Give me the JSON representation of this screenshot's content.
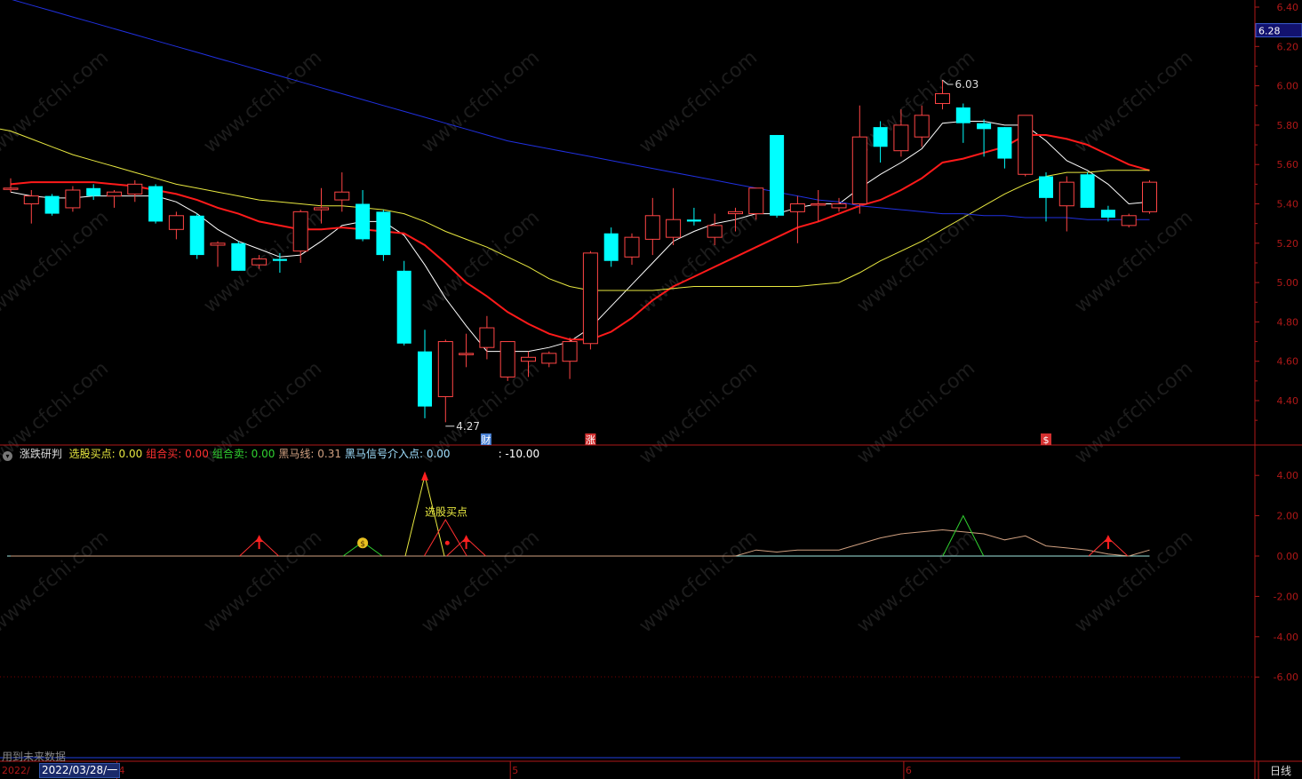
{
  "chart_data": [
    {
      "type": "candlestick",
      "ylim": [
        4.2,
        6.4
      ],
      "y_ticks": [
        "6.40",
        "6.20",
        "6.00",
        "5.80",
        "5.60",
        "5.40",
        "5.20",
        "5.00",
        "4.80",
        "4.60",
        "4.40"
      ],
      "price_marker": "6.28",
      "annotations": {
        "high_label": "6.03",
        "low_label": "4.27"
      },
      "event_markers": [
        {
          "label": "财",
          "index": 23,
          "color": "#4b83d6"
        },
        {
          "label": "涨",
          "index": 28,
          "color": "#d23030"
        },
        {
          "label": "$",
          "index": 50,
          "color": "#d23030"
        }
      ],
      "candles": [
        {
          "o": 5.48,
          "h": 5.53,
          "l": 5.46,
          "c": 5.48
        },
        {
          "o": 5.4,
          "h": 5.47,
          "l": 5.3,
          "c": 5.44
        },
        {
          "o": 5.44,
          "h": 5.45,
          "l": 5.34,
          "c": 5.35
        },
        {
          "o": 5.38,
          "h": 5.49,
          "l": 5.36,
          "c": 5.47
        },
        {
          "o": 5.48,
          "h": 5.5,
          "l": 5.42,
          "c": 5.44
        },
        {
          "o": 5.44,
          "h": 5.47,
          "l": 5.38,
          "c": 5.46
        },
        {
          "o": 5.45,
          "h": 5.52,
          "l": 5.41,
          "c": 5.5
        },
        {
          "o": 5.49,
          "h": 5.5,
          "l": 5.3,
          "c": 5.31
        },
        {
          "o": 5.27,
          "h": 5.36,
          "l": 5.22,
          "c": 5.34
        },
        {
          "o": 5.34,
          "h": 5.35,
          "l": 5.12,
          "c": 5.14
        },
        {
          "o": 5.19,
          "h": 5.21,
          "l": 5.08,
          "c": 5.2
        },
        {
          "o": 5.2,
          "h": 5.21,
          "l": 5.06,
          "c": 5.06
        },
        {
          "o": 5.09,
          "h": 5.14,
          "l": 5.07,
          "c": 5.12
        },
        {
          "o": 5.12,
          "h": 5.15,
          "l": 5.05,
          "c": 5.11
        },
        {
          "o": 5.16,
          "h": 5.37,
          "l": 5.1,
          "c": 5.36
        },
        {
          "o": 5.37,
          "h": 5.48,
          "l": 5.3,
          "c": 5.38
        },
        {
          "o": 5.42,
          "h": 5.56,
          "l": 5.36,
          "c": 5.46
        },
        {
          "o": 5.4,
          "h": 5.47,
          "l": 5.21,
          "c": 5.22
        },
        {
          "o": 5.36,
          "h": 5.37,
          "l": 5.11,
          "c": 5.14
        },
        {
          "o": 5.06,
          "h": 5.11,
          "l": 4.68,
          "c": 4.69
        },
        {
          "o": 4.65,
          "h": 4.76,
          "l": 4.31,
          "c": 4.37
        },
        {
          "o": 4.42,
          "h": 4.71,
          "l": 4.29,
          "c": 4.7
        },
        {
          "o": 4.64,
          "h": 4.74,
          "l": 4.57,
          "c": 4.64
        },
        {
          "o": 4.67,
          "h": 4.83,
          "l": 4.61,
          "c": 4.77
        },
        {
          "o": 4.52,
          "h": 4.7,
          "l": 4.5,
          "c": 4.7
        },
        {
          "o": 4.6,
          "h": 4.65,
          "l": 4.52,
          "c": 4.62
        },
        {
          "o": 4.59,
          "h": 4.65,
          "l": 4.57,
          "c": 4.64
        },
        {
          "o": 4.6,
          "h": 4.72,
          "l": 4.51,
          "c": 4.7
        },
        {
          "o": 4.69,
          "h": 5.16,
          "l": 4.66,
          "c": 5.15
        },
        {
          "o": 5.25,
          "h": 5.28,
          "l": 5.08,
          "c": 5.11
        },
        {
          "o": 5.13,
          "h": 5.25,
          "l": 5.09,
          "c": 5.23
        },
        {
          "o": 5.22,
          "h": 5.43,
          "l": 5.14,
          "c": 5.34
        },
        {
          "o": 5.23,
          "h": 5.48,
          "l": 5.19,
          "c": 5.32
        },
        {
          "o": 5.32,
          "h": 5.38,
          "l": 5.29,
          "c": 5.31
        },
        {
          "o": 5.23,
          "h": 5.35,
          "l": 5.19,
          "c": 5.29
        },
        {
          "o": 5.35,
          "h": 5.38,
          "l": 5.26,
          "c": 5.36
        },
        {
          "o": 5.35,
          "h": 5.48,
          "l": 5.32,
          "c": 5.48
        },
        {
          "o": 5.75,
          "h": 5.75,
          "l": 5.33,
          "c": 5.34
        },
        {
          "o": 5.36,
          "h": 5.44,
          "l": 5.2,
          "c": 5.4
        },
        {
          "o": 5.4,
          "h": 5.47,
          "l": 5.31,
          "c": 5.4
        },
        {
          "o": 5.38,
          "h": 5.43,
          "l": 5.36,
          "c": 5.4
        },
        {
          "o": 5.4,
          "h": 5.9,
          "l": 5.35,
          "c": 5.74
        },
        {
          "o": 5.79,
          "h": 5.82,
          "l": 5.61,
          "c": 5.69
        },
        {
          "o": 5.67,
          "h": 5.88,
          "l": 5.64,
          "c": 5.8
        },
        {
          "o": 5.74,
          "h": 5.9,
          "l": 5.69,
          "c": 5.85
        },
        {
          "o": 5.91,
          "h": 6.03,
          "l": 5.88,
          "c": 5.96
        },
        {
          "o": 5.89,
          "h": 5.91,
          "l": 5.71,
          "c": 5.81
        },
        {
          "o": 5.81,
          "h": 5.83,
          "l": 5.64,
          "c": 5.78
        },
        {
          "o": 5.79,
          "h": 5.79,
          "l": 5.58,
          "c": 5.63
        },
        {
          "o": 5.55,
          "h": 5.85,
          "l": 5.54,
          "c": 5.85
        },
        {
          "o": 5.54,
          "h": 5.56,
          "l": 5.31,
          "c": 5.43
        },
        {
          "o": 5.39,
          "h": 5.54,
          "l": 5.26,
          "c": 5.51
        },
        {
          "o": 5.55,
          "h": 5.56,
          "l": 5.38,
          "c": 5.38
        },
        {
          "o": 5.37,
          "h": 5.39,
          "l": 5.31,
          "c": 5.33
        },
        {
          "o": 5.29,
          "h": 5.35,
          "l": 5.28,
          "c": 5.34
        },
        {
          "o": 5.36,
          "h": 5.52,
          "l": 5.35,
          "c": 5.51
        }
      ],
      "ma_lines": [
        {
          "name": "MA5",
          "color": "#ffffff",
          "width": 1,
          "values": [
            5.46,
            5.44,
            5.43,
            5.43,
            5.44,
            5.44,
            5.44,
            5.44,
            5.41,
            5.35,
            5.27,
            5.21,
            5.17,
            5.13,
            5.14,
            5.21,
            5.29,
            5.31,
            5.31,
            5.24,
            5.09,
            4.92,
            4.78,
            4.65,
            4.65,
            4.65,
            4.67,
            4.7,
            4.77,
            4.88,
            4.99,
            5.1,
            5.21,
            5.26,
            5.3,
            5.32,
            5.35,
            5.35,
            5.38,
            5.4,
            5.4,
            5.48,
            5.55,
            5.61,
            5.68,
            5.81,
            5.82,
            5.82,
            5.8,
            5.8,
            5.72,
            5.62,
            5.57,
            5.5,
            5.4,
            5.41
          ]
        },
        {
          "name": "MA10",
          "color": "#ff1a1a",
          "width": 2,
          "values": [
            5.5,
            5.51,
            5.51,
            5.51,
            5.51,
            5.5,
            5.49,
            5.47,
            5.45,
            5.42,
            5.38,
            5.35,
            5.31,
            5.29,
            5.27,
            5.27,
            5.28,
            5.27,
            5.26,
            5.25,
            5.19,
            5.1,
            5.0,
            4.93,
            4.85,
            4.79,
            4.74,
            4.71,
            4.71,
            4.75,
            4.82,
            4.91,
            4.98,
            5.03,
            5.08,
            5.13,
            5.18,
            5.23,
            5.28,
            5.31,
            5.35,
            5.39,
            5.42,
            5.47,
            5.53,
            5.61,
            5.63,
            5.66,
            5.69,
            5.75,
            5.75,
            5.73,
            5.7,
            5.65,
            5.6,
            5.57
          ]
        },
        {
          "name": "MA20",
          "color": "#e8e840",
          "width": 1,
          "values": [
            5.77,
            5.73,
            5.69,
            5.65,
            5.62,
            5.59,
            5.56,
            5.53,
            5.5,
            5.48,
            5.46,
            5.44,
            5.42,
            5.41,
            5.4,
            5.39,
            5.39,
            5.38,
            5.37,
            5.35,
            5.31,
            5.26,
            5.22,
            5.18,
            5.13,
            5.08,
            5.02,
            4.98,
            4.96,
            4.96,
            4.96,
            4.96,
            4.97,
            4.98,
            4.98,
            4.98,
            4.98,
            4.98,
            4.98,
            4.99,
            5.0,
            5.05,
            5.11,
            5.16,
            5.21,
            5.27,
            5.33,
            5.39,
            5.45,
            5.5,
            5.54,
            5.56,
            5.56,
            5.57,
            5.57,
            5.57
          ]
        },
        {
          "name": "MA60",
          "color": "#2030e0",
          "width": 1,
          "values": [
            6.44,
            6.41,
            6.38,
            6.35,
            6.32,
            6.29,
            6.26,
            6.23,
            6.2,
            6.17,
            6.14,
            6.11,
            6.08,
            6.05,
            6.02,
            5.99,
            5.96,
            5.93,
            5.9,
            5.87,
            5.84,
            5.81,
            5.78,
            5.75,
            5.72,
            5.7,
            5.68,
            5.66,
            5.64,
            5.62,
            5.6,
            5.58,
            5.56,
            5.54,
            5.52,
            5.5,
            5.48,
            5.46,
            5.44,
            5.42,
            5.41,
            5.39,
            5.38,
            5.37,
            5.36,
            5.35,
            5.35,
            5.34,
            5.34,
            5.33,
            5.33,
            5.33,
            5.32,
            5.32,
            5.32,
            5.32
          ]
        }
      ]
    },
    {
      "type": "line",
      "ylim": [
        -10,
        5
      ],
      "y_ticks": [
        "4.00",
        "2.00",
        "0.00",
        "-2.00",
        "-4.00",
        "-6.00"
      ],
      "annotation_label": "选股买点",
      "peaks_red": [
        12,
        22,
        53
      ],
      "peak_green_small": 17,
      "peak_yellow": 20,
      "peak_green": 46,
      "dot_red_index": 21,
      "heima_line": [
        0,
        0,
        0,
        0,
        0,
        0,
        0,
        0,
        0,
        0,
        0,
        0,
        0,
        0,
        0,
        0,
        0,
        0,
        0,
        0,
        0,
        0,
        0,
        0,
        0,
        0,
        0,
        0,
        0,
        0,
        0,
        0,
        0,
        0,
        0,
        0,
        0.3,
        0.2,
        0.3,
        0.3,
        0.3,
        0.6,
        0.9,
        1.1,
        1.2,
        1.3,
        1.2,
        1.1,
        0.8,
        1.0,
        0.5,
        0.4,
        0.3,
        0.1,
        0,
        0.3
      ],
      "header": {
        "title": "涨跌研判",
        "items": [
          {
            "label": "选股买点: 0.00",
            "color": "#e8e840"
          },
          {
            "label": "组合买: 0.00",
            "color": "#ff3030"
          },
          {
            "label": "组合卖: 0.00",
            "color": "#30d030"
          },
          {
            "label": "黑马线: 0.31",
            "color": "#d0a080"
          },
          {
            "label": "黑马信号介入点: 0.00",
            "color": "#a0e0ff"
          },
          {
            "label": ": -10.00",
            "color": "#ffffff"
          }
        ]
      }
    }
  ],
  "xaxis": {
    "labels": [
      {
        "text": "4",
        "index": 5
      },
      {
        "text": "5",
        "index": 24
      },
      {
        "text": "6",
        "index": 43
      }
    ],
    "left_text": "2022/",
    "date_box": "2022/03/28/一",
    "period": "日线"
  },
  "future_note": "用到未来数据",
  "watermark": "www.cfchi.com",
  "colors": {
    "up": "#ff4545",
    "down": "#00ffff",
    "axis": "#b01818",
    "grid": "#7a0000"
  }
}
